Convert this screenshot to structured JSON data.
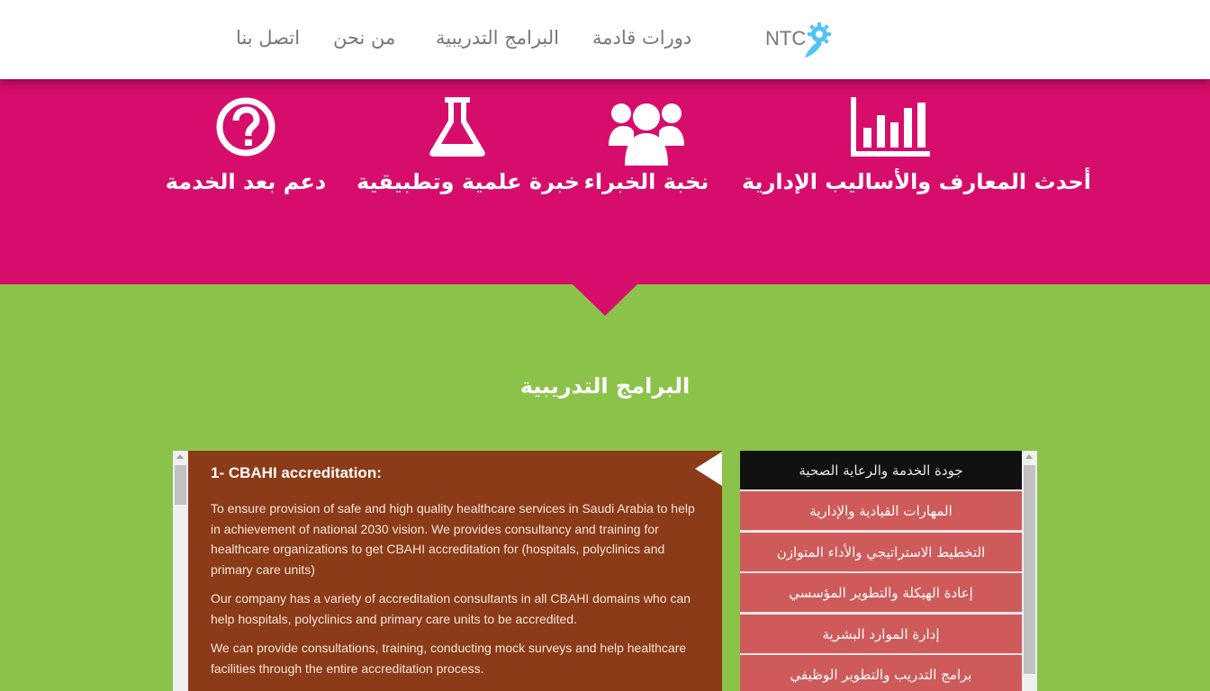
{
  "header": {
    "logo_text": "NTC",
    "nav": [
      {
        "label": "دورات قادمة"
      },
      {
        "label": "البرامج التدريبية"
      },
      {
        "label": "من نحن"
      },
      {
        "label": "اتصل بنا"
      }
    ]
  },
  "features": [
    {
      "label": "أحدث المعارف والأساليب الإدارية",
      "icon": "bar-chart-icon"
    },
    {
      "label": "نخبة الخبراء",
      "icon": "users-icon"
    },
    {
      "label": "خبرة علمية وتطبيقية",
      "icon": "flask-icon"
    },
    {
      "label": "دعم بعد الخدمة",
      "icon": "question-circle-icon"
    }
  ],
  "section_title": "البرامج التدريبية",
  "panel": {
    "heading": "1- CBAHI accreditation:",
    "paragraphs": [
      "To ensure provision of safe and high quality healthcare services in Saudi Arabia to help in achievement of national 2030 vision. We provides consultancy and training for healthcare organizations to get CBAHI accreditation for (hospitals, polyclinics and primary care units)",
      "Our company has a variety of accreditation consultants in all CBAHI domains who can help hospitals, polyclinics and primary care units to be accredited.",
      "We can provide consultations, training, conducting mock surveys and help healthcare facilities through the entire accreditation process."
    ]
  },
  "programs": [
    {
      "label": "جودة الخدمة والرعاية الصحية",
      "active": true
    },
    {
      "label": "المهارات القيادية والإدارية",
      "active": false
    },
    {
      "label": "التخطيط الاستراتيجي والأداء المتوازن",
      "active": false
    },
    {
      "label": "إعادة الهيكلة والتطوير المؤسسي",
      "active": false
    },
    {
      "label": "إدارة الموارد البشرية",
      "active": false
    },
    {
      "label": "برامج التدريب والتطوير الوظيفي",
      "active": false
    }
  ],
  "colors": {
    "header_bg": "#ffffff",
    "pink_band": "#d60d6b",
    "green_bg": "#8bc34a",
    "panel_bg": "#8b3b17",
    "list_item_bg": "#cf5a5a",
    "list_item_active_bg": "#111111",
    "logo_accent": "#4fc3f7"
  }
}
